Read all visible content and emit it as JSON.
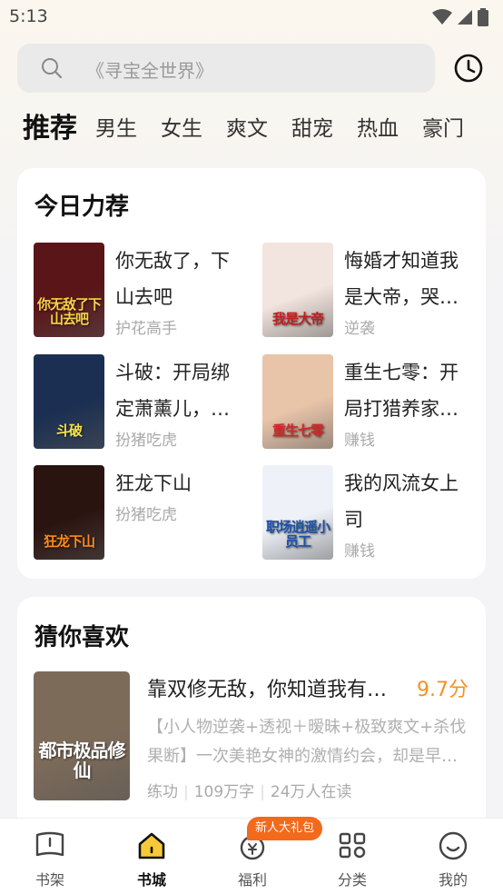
{
  "status": {
    "time": "5:13"
  },
  "search": {
    "placeholder": "《寻宝全世界》"
  },
  "tabs": [
    "推荐",
    "男生",
    "女生",
    "爽文",
    "甜宠",
    "热血",
    "豪门"
  ],
  "recommend": {
    "title": "今日力荐",
    "books": [
      {
        "title": "你无敌了，下山去吧",
        "author": "护花高手",
        "cover_text": "你无敌了下山去吧",
        "cover_bg": "#5a1518",
        "cover_color": "#f7d24a"
      },
      {
        "title": "悔婚才知道我是大帝，哭…",
        "author": "逆袭",
        "cover_text": "我是大帝",
        "cover_bg": "#f2e4de",
        "cover_color": "#c02020"
      },
      {
        "title": "斗破：开局绑定萧薰儿，…",
        "author": "扮猪吃虎",
        "cover_text": "斗破",
        "cover_bg": "#1b2f52",
        "cover_color": "#f5e24a"
      },
      {
        "title": "重生七零：开局打猎养家…",
        "author": "赚钱",
        "cover_text": "重生七零",
        "cover_bg": "#e8c4a9",
        "cover_color": "#d02828"
      },
      {
        "title": "狂龙下山",
        "author": "扮猪吃虎",
        "cover_text": "狂龙下山",
        "cover_bg": "#2a1410",
        "cover_color": "#ff8a1c"
      },
      {
        "title": "我的风流女上司",
        "author": "赚钱",
        "cover_text": "职场逍遥小员工",
        "cover_bg": "#eef2f8",
        "cover_color": "#1e4fa8"
      }
    ]
  },
  "guess": {
    "title": "猜你喜欢",
    "book": {
      "title": "靠双修无敌，你知道我有…",
      "score": "9.7分",
      "desc": "【小人物逆袭+透视＋暧昧+极致爽文+杀伐果断】一次美艳女神的激情约会，却是早…",
      "tag": "练功",
      "words": "109万字",
      "readers": "24万人在读",
      "cover_text": "都市极品修仙",
      "cover_bg": "#7d6b5a",
      "cover_color": "#ffffff"
    }
  },
  "nav": {
    "items": [
      "书架",
      "书城",
      "福利",
      "分类",
      "我的"
    ],
    "active": "书城",
    "badge": "新人大礼包"
  },
  "colors": {
    "accent": "#f5921f",
    "badge": "#f26a1b"
  }
}
